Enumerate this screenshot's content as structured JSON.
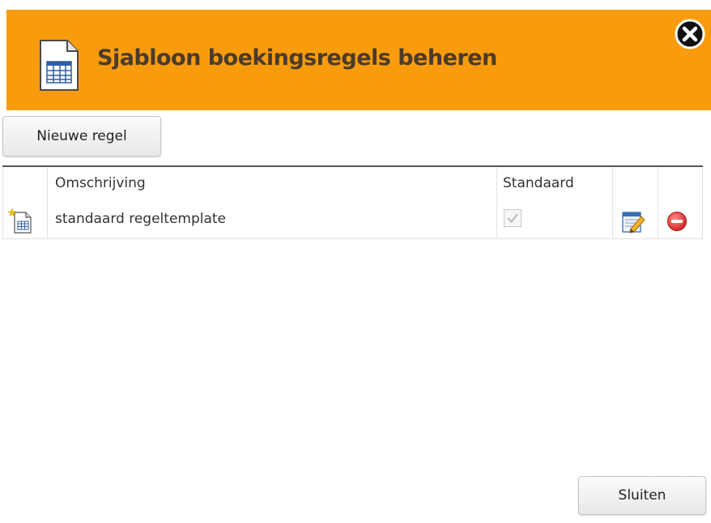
{
  "dialog": {
    "title": "Sjabloon boekingsregels beheren",
    "header_icon": "document-table-icon",
    "close_icon": "close-circle-icon",
    "accent_color": "#f89c0e"
  },
  "toolbar": {
    "new_rule_label": "Nieuwe regel"
  },
  "table": {
    "columns": [
      "Omschrijving",
      "Standaard"
    ],
    "rows": [
      {
        "icon": "new-template-icon",
        "omschrijving": "standaard regeltemplate",
        "standaard": true,
        "edit_icon": "edit-icon",
        "delete_icon": "delete-icon"
      }
    ]
  },
  "footer": {
    "close_label": "Sluiten"
  }
}
